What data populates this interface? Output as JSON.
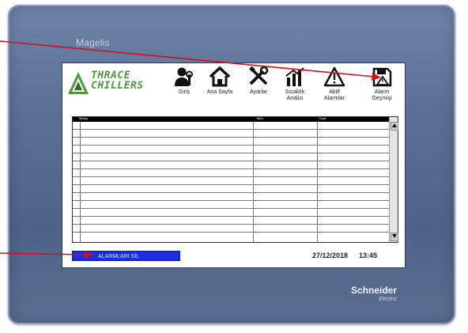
{
  "bezel": {
    "top_brand": "Magelis",
    "bottom_brand": "Schneider",
    "bottom_brand_sub": "Electric"
  },
  "header": {
    "logo_line1": "THRACE",
    "logo_line2": "CHILLERS",
    "nav": [
      {
        "label_line1": "Giriş",
        "label_line2": "",
        "icon": "user-wrench-icon"
      },
      {
        "label_line1": "Ana Sayfa",
        "label_line2": "",
        "icon": "home-icon"
      },
      {
        "label_line1": "Ayarlar",
        "label_line2": "",
        "icon": "tools-icon"
      },
      {
        "label_line1": "Sıcaklık",
        "label_line2": "Analizi",
        "icon": "bar-chart-icon"
      },
      {
        "label_line1": "Aktif",
        "label_line2": "Alarmlar",
        "icon": "warning-icon"
      },
      {
        "label_line1": "Alarm",
        "label_line2": "Geçmişi",
        "icon": "save-alarm-icon"
      }
    ]
  },
  "table": {
    "columns": [
      "Mesaj",
      "Tarih",
      "Saat"
    ]
  },
  "footer": {
    "delete_label": "ALARMLARI SİL",
    "date": "27/12/2018",
    "time": "13:45"
  },
  "colors": {
    "bezel": "#5b6f95",
    "logo_green": "#4f9a3e",
    "delete_button": "#1b2fe0",
    "annotation_arrow": "#d0101a"
  }
}
